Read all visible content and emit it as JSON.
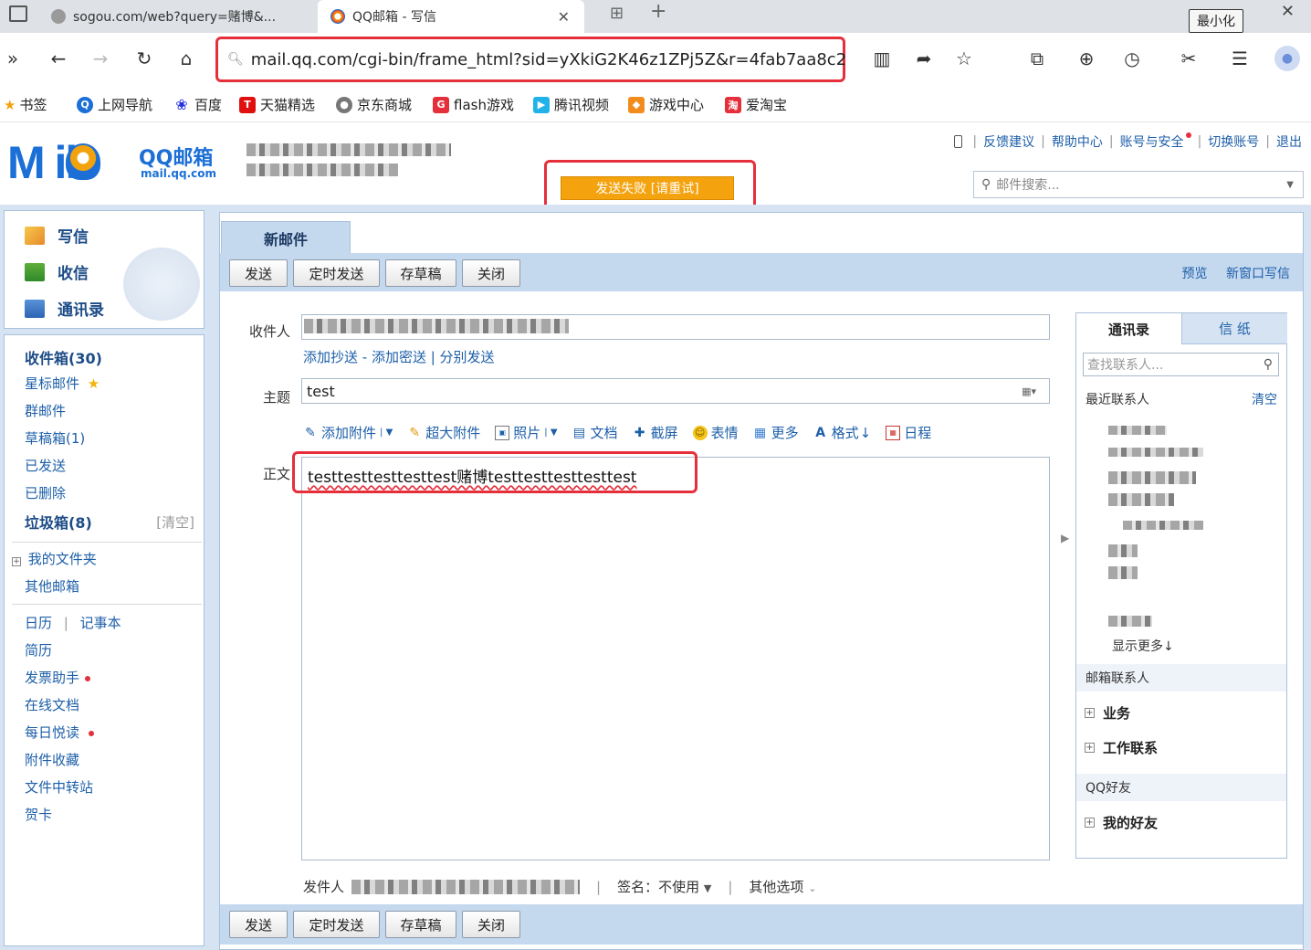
{
  "browser": {
    "tabs": [
      {
        "label": "sogou.com/web?query=赌博&..."
      },
      {
        "label": "QQ邮箱 - 写信"
      }
    ],
    "minimize_tooltip": "最小化",
    "url": "mail.qq.com/cgi-bin/frame_html?sid=yXkiG2K46z1ZPj5Z&r=4fab7aa8c2",
    "bookmarks": [
      "书签",
      "上网导航",
      "百度",
      "天猫精选",
      "京东商城",
      "flash游戏",
      "腾讯视频",
      "游戏中心",
      "爱淘宝"
    ]
  },
  "header": {
    "logo": "M  il",
    "brand": "QQ邮箱",
    "brand_sub": "mail.qq.com",
    "links": [
      "反馈建议",
      "帮助中心",
      "账号与安全",
      "切换账号",
      "退出"
    ],
    "search_placeholder": "邮件搜索...",
    "send_status": "发送失败 [请重试]"
  },
  "sidebar": {
    "quick": [
      "写信",
      "收信",
      "通讯录"
    ],
    "folders": {
      "inbox": "收件箱(30)",
      "starred": "星标邮件",
      "group": "群邮件",
      "drafts": "草稿箱(1)",
      "sent": "已发送",
      "deleted": "已删除",
      "spam": "垃圾箱(8)",
      "spam_clear": "[清空]",
      "my_folders": "我的文件夹",
      "other": "其他邮箱"
    },
    "apps": {
      "calendar": "日历",
      "notebook": "记事本",
      "resume": "简历",
      "invoice": "发票助手",
      "docs": "在线文档",
      "daily": "每日悦读",
      "attachments": "附件收藏",
      "transfer": "文件中转站",
      "cards": "贺卡"
    }
  },
  "compose": {
    "tab": "新邮件",
    "buttons": [
      "发送",
      "定时发送",
      "存草稿",
      "关闭"
    ],
    "preview": "预览",
    "new_window": "新窗口写信",
    "to_label": "收件人",
    "cc_links": "添加抄送 - 添加密送 | 分别发送",
    "subject_label": "主题",
    "subject_value": "test",
    "tools": [
      "添加附件",
      "超大附件",
      "照片",
      "文档",
      "截屏",
      "表情",
      "更多",
      "格式",
      "日程"
    ],
    "body_label": "正文",
    "body_value": "testtesttesttesttest赌博testtesttesttesttest",
    "sender_label": "发件人",
    "signature": "签名：不使用",
    "more_options": "其他选项"
  },
  "contacts": {
    "tabs": [
      "通讯录",
      "信 纸"
    ],
    "search_placeholder": "查找联系人...",
    "recent": "最近联系人",
    "clear": "清空",
    "show_more": "显示更多",
    "mail_contacts": "邮箱联系人",
    "groups_mail": [
      "业务",
      "工作联系"
    ],
    "qq_friends": "QQ好友",
    "groups_qq": [
      "我的好友"
    ]
  }
}
